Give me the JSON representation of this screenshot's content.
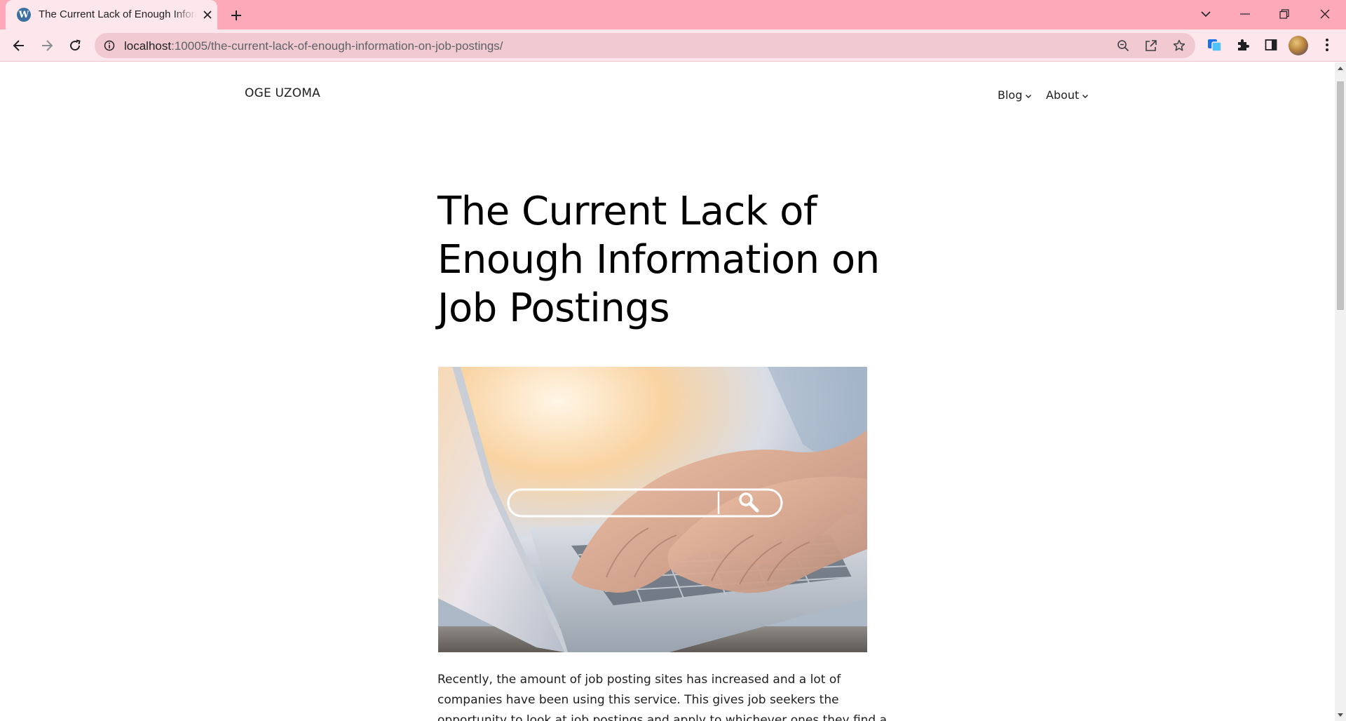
{
  "browser": {
    "tab": {
      "title": "The Current Lack of Enough Information on Job Postings",
      "favicon": "wordpress-icon"
    },
    "url": {
      "host": "localhost",
      "path": ":10005/the-current-lack-of-enough-information-on-job-postings/"
    },
    "toolbar_icons": [
      "back-icon",
      "forward-icon",
      "reload-icon",
      "site-info-icon",
      "zoom-icon",
      "share-icon",
      "bookmark-star-icon",
      "screen-capture-extension-icon",
      "extensions-puzzle-icon",
      "side-panel-icon",
      "profile-avatar",
      "menu-kebab-icon"
    ],
    "window_controls": [
      "tab-search-icon",
      "minimize-icon",
      "restore-icon",
      "close-window-icon"
    ],
    "colors": {
      "tabbar": "#fda9b9",
      "toolbar": "#fde7ec",
      "omnibox": "#f0c9d1"
    }
  },
  "site": {
    "title": "OGE UZOMA",
    "nav": [
      {
        "label": "Blog"
      },
      {
        "label": "About"
      }
    ]
  },
  "post": {
    "title": "The Current Lack of Enough Information on Job Postings",
    "image": "hands-typing-on-laptop-with-search-bar-overlay",
    "body_excerpt": "Recently, the amount of job posting sites has increased and a lot of companies have been using this service. This gives job seekers the opportunity to look at job postings and apply to whichever ones they find a good fit."
  }
}
